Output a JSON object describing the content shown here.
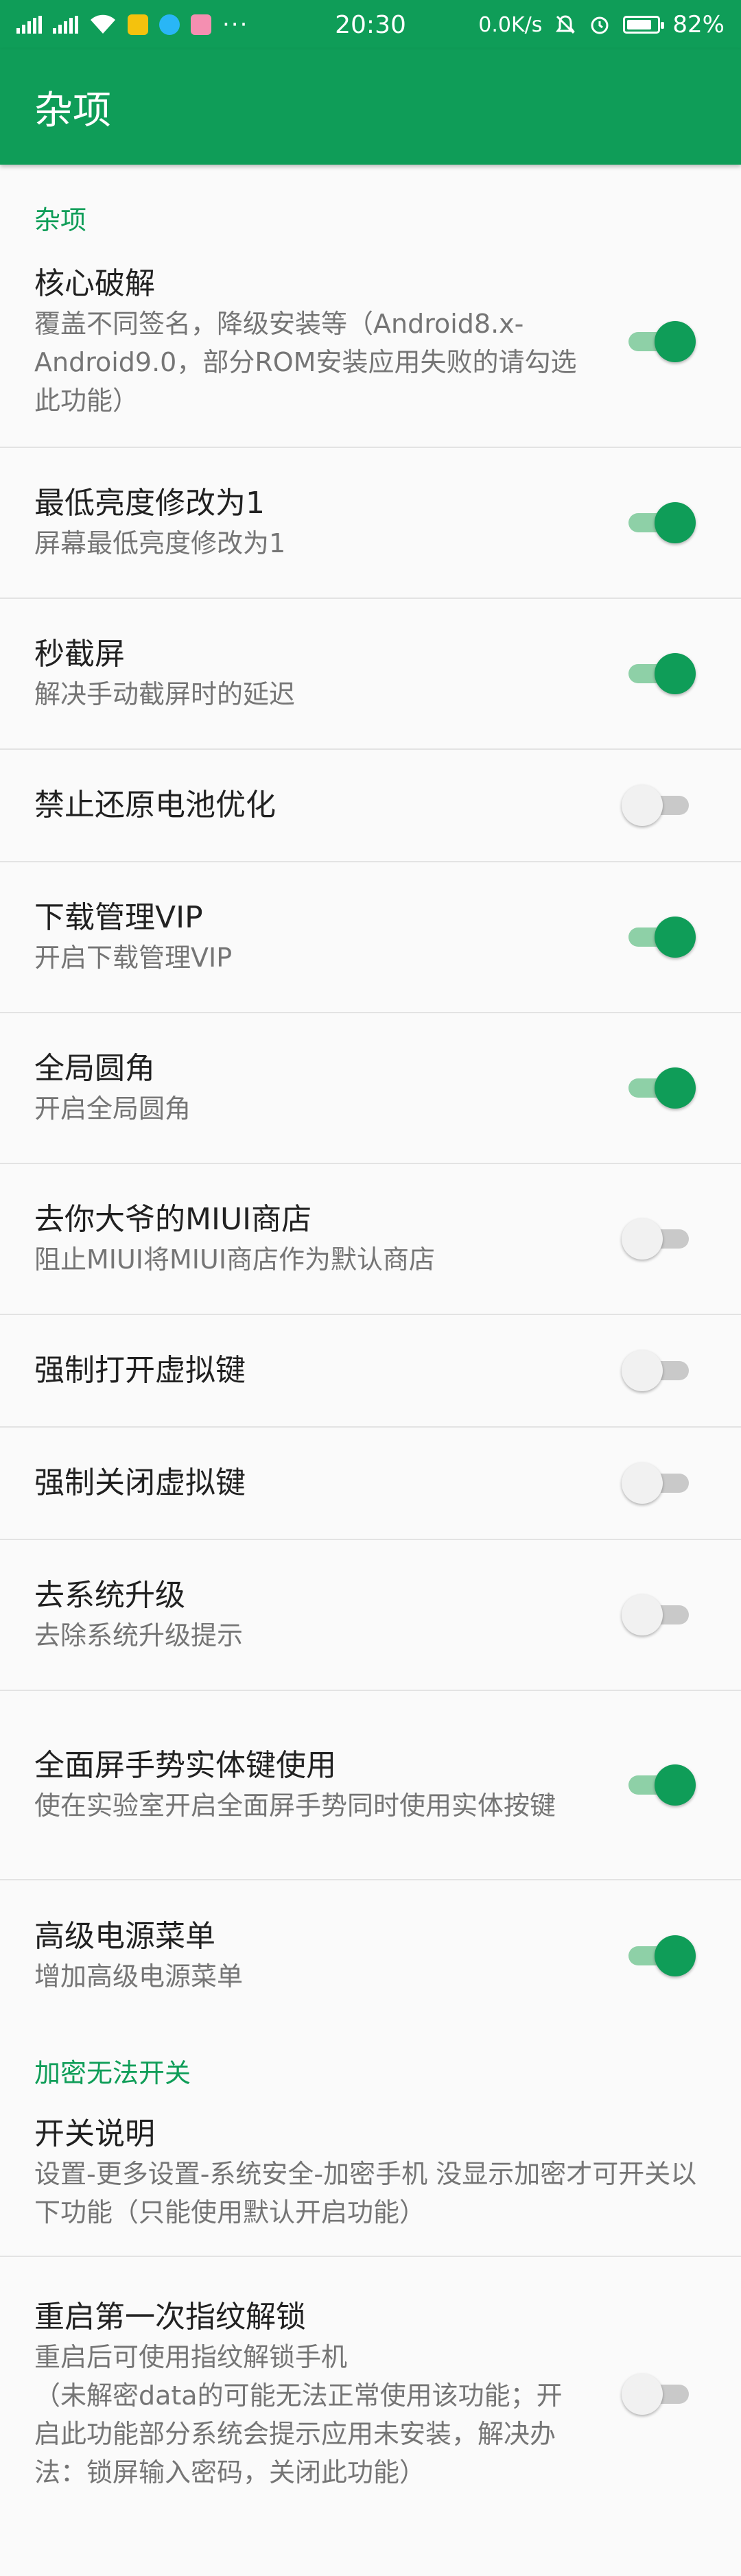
{
  "status_bar": {
    "time": "20:30",
    "network_speed": "0.0K/s",
    "battery": "82%",
    "battery_level": 0.82,
    "more": "···",
    "icons": [
      "signal-icon",
      "signal-icon",
      "wifi-icon",
      "app-notification-icon",
      "app-notification-icon",
      "app-notification-icon",
      "mute-icon",
      "alarm-icon",
      "battery-icon"
    ]
  },
  "app_bar": {
    "title": "杂项"
  },
  "colors": {
    "accent": "#0f9d58",
    "switch_on_track": "#8ed0a7",
    "switch_off_track": "#c9c9c9"
  },
  "sections": [
    {
      "header": "杂项",
      "items": [
        {
          "title": "核心破解",
          "summary": "覆盖不同签名，降级安装等（Android8.x-Android9.0，部分ROM安装应用失败的请勾选此功能）",
          "on": true
        },
        {
          "title": "最低亮度修改为1",
          "summary": "屏幕最低亮度修改为1",
          "on": true
        },
        {
          "title": "秒截屏",
          "summary": "解决手动截屏时的延迟",
          "on": true
        },
        {
          "title": "禁止还原电池优化",
          "summary": "",
          "on": false
        },
        {
          "title": "下载管理VIP",
          "summary": "开启下载管理VIP",
          "on": true
        },
        {
          "title": "全局圆角",
          "summary": "开启全局圆角",
          "on": true
        },
        {
          "title": "去你大爷的MIUI商店",
          "summary": "阻止MIUI将MIUI商店作为默认商店",
          "on": false
        },
        {
          "title": "强制打开虚拟键",
          "summary": "",
          "on": false
        },
        {
          "title": "强制关闭虚拟键",
          "summary": "",
          "on": false
        },
        {
          "title": "去系统升级",
          "summary": "去除系统升级提示",
          "on": false
        },
        {
          "title": "全面屏手势实体键使用",
          "summary": "使在实验室开启全面屏手势同时使用实体按键",
          "on": true
        },
        {
          "title": "高级电源菜单",
          "summary": "增加高级电源菜单",
          "on": true
        }
      ]
    },
    {
      "header": "加密无法开关",
      "items": [
        {
          "title": "开关说明",
          "summary": "设置-更多设置-系统安全-加密手机 没显示加密才可开关以下功能（只能使用默认开启功能）",
          "on": null
        },
        {
          "title": "重启第一次指纹解锁",
          "summary": "重启后可使用指纹解锁手机\n（未解密data的可能无法正常使用该功能；开启此功能部分系统会提示应用未安装，解决办法：锁屏输入密码，关闭此功能）",
          "on": false
        }
      ]
    }
  ]
}
